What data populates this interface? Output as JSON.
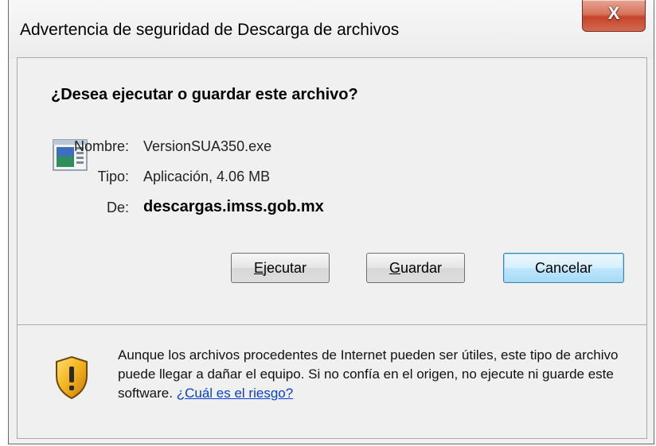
{
  "window": {
    "title": "Advertencia de seguridad de Descarga de archivos",
    "close_glyph": "X"
  },
  "dialog": {
    "question": "¿Desea ejecutar o guardar este archivo?",
    "file_icon": "application-window-icon",
    "name_label": "Nombre:",
    "name_value": "VersionSUA350.exe",
    "type_label": "Tipo:",
    "type_value": "Aplicación, 4.06 MB",
    "from_label": "De:",
    "from_value": "descargas.imss.gob.mx"
  },
  "buttons": {
    "run": {
      "mnemonic": "E",
      "rest": "jecutar"
    },
    "save": {
      "mnemonic": "G",
      "rest": "uardar"
    },
    "cancel": "Cancelar"
  },
  "warning": {
    "icon": "shield-warning-icon",
    "text": "Aunque los archivos procedentes de Internet pueden ser útiles, este tipo de archivo puede llegar a dañar el equipo. Si no confía en el origen, no ejecute ni guarde este software.",
    "link": "¿Cuál es el riesgo?"
  },
  "colors": {
    "accent_link": "#0a3fd6",
    "close_red": "#c4442a",
    "primary_button_border": "#3c7fb1"
  }
}
